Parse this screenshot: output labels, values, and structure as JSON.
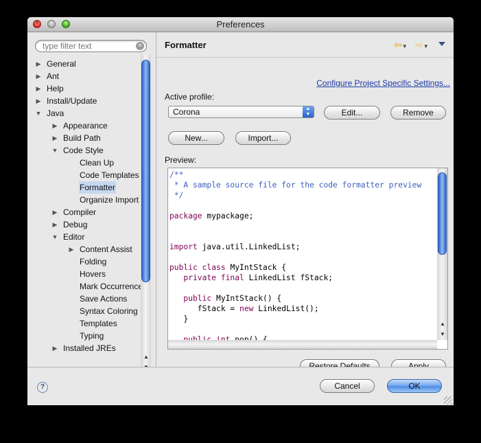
{
  "window": {
    "title": "Preferences"
  },
  "filter": {
    "placeholder": "type filter text"
  },
  "tree": [
    {
      "label": "General",
      "twisty": "collapsed",
      "level": 0,
      "selected": false
    },
    {
      "label": "Ant",
      "twisty": "collapsed",
      "level": 0,
      "selected": false
    },
    {
      "label": "Help",
      "twisty": "collapsed",
      "level": 0,
      "selected": false
    },
    {
      "label": "Install/Update",
      "twisty": "collapsed",
      "level": 0,
      "selected": false
    },
    {
      "label": "Java",
      "twisty": "expanded",
      "level": 0,
      "selected": false
    },
    {
      "label": "Appearance",
      "twisty": "collapsed",
      "level": 1,
      "selected": false
    },
    {
      "label": "Build Path",
      "twisty": "collapsed",
      "level": 1,
      "selected": false
    },
    {
      "label": "Code Style",
      "twisty": "expanded",
      "level": 1,
      "selected": false
    },
    {
      "label": "Clean Up",
      "twisty": "none",
      "level": 2,
      "selected": false
    },
    {
      "label": "Code Templates",
      "twisty": "none",
      "level": 2,
      "selected": false
    },
    {
      "label": "Formatter",
      "twisty": "none",
      "level": 2,
      "selected": true
    },
    {
      "label": "Organize Import",
      "twisty": "none",
      "level": 2,
      "selected": false
    },
    {
      "label": "Compiler",
      "twisty": "collapsed",
      "level": 1,
      "selected": false
    },
    {
      "label": "Debug",
      "twisty": "collapsed",
      "level": 1,
      "selected": false
    },
    {
      "label": "Editor",
      "twisty": "expanded",
      "level": 1,
      "selected": false
    },
    {
      "label": "Content Assist",
      "twisty": "collapsed",
      "level": 2,
      "selected": false
    },
    {
      "label": "Folding",
      "twisty": "none",
      "level": 2,
      "selected": false
    },
    {
      "label": "Hovers",
      "twisty": "none",
      "level": 2,
      "selected": false
    },
    {
      "label": "Mark Occurrences",
      "twisty": "none",
      "level": 2,
      "selected": false
    },
    {
      "label": "Save Actions",
      "twisty": "none",
      "level": 2,
      "selected": false
    },
    {
      "label": "Syntax Coloring",
      "twisty": "none",
      "level": 2,
      "selected": false
    },
    {
      "label": "Templates",
      "twisty": "none",
      "level": 2,
      "selected": false
    },
    {
      "label": "Typing",
      "twisty": "none",
      "level": 2,
      "selected": false
    },
    {
      "label": "Installed JREs",
      "twisty": "collapsed",
      "level": 1,
      "selected": false
    }
  ],
  "page": {
    "title": "Formatter",
    "configure_link": "Configure Project Specific Settings...",
    "active_profile_label": "Active profile:",
    "profile_value": "Corona",
    "edit_label": "Edit...",
    "remove_label": "Remove",
    "new_label": "New...",
    "import_label": "Import...",
    "preview_label": "Preview:",
    "restore_defaults_label": "Restore Defaults",
    "apply_label": "Apply"
  },
  "preview_code": [
    [
      [
        "comment",
        "/**"
      ]
    ],
    [
      [
        "comment",
        " * A sample source file for the code formatter preview"
      ]
    ],
    [
      [
        "comment",
        " */"
      ]
    ],
    [],
    [
      [
        "kw",
        "package"
      ],
      [
        "plain",
        " mypackage;"
      ]
    ],
    [],
    [],
    [
      [
        "kw",
        "import"
      ],
      [
        "plain",
        " java.util.LinkedList;"
      ]
    ],
    [],
    [
      [
        "kw",
        "public"
      ],
      [
        "plain",
        " "
      ],
      [
        "kw",
        "class"
      ],
      [
        "plain",
        " MyIntStack {"
      ]
    ],
    [
      [
        "plain",
        "   "
      ],
      [
        "kw",
        "private"
      ],
      [
        "plain",
        " "
      ],
      [
        "kw",
        "final"
      ],
      [
        "plain",
        " LinkedList fStack;"
      ]
    ],
    [],
    [
      [
        "plain",
        "   "
      ],
      [
        "kw",
        "public"
      ],
      [
        "plain",
        " MyIntStack() {"
      ]
    ],
    [
      [
        "plain",
        "      fStack = "
      ],
      [
        "kw",
        "new"
      ],
      [
        "plain",
        " LinkedList();"
      ]
    ],
    [
      [
        "plain",
        "   }"
      ]
    ],
    [],
    [
      [
        "plain",
        "   "
      ],
      [
        "kw",
        "public"
      ],
      [
        "plain",
        " "
      ],
      [
        "kw",
        "int"
      ],
      [
        "plain",
        " pop() {"
      ]
    ]
  ],
  "footer": {
    "help_glyph": "?",
    "cancel_label": "Cancel",
    "ok_label": "OK"
  },
  "icons": {
    "close": "close-icon",
    "minimize": "minimize-icon",
    "zoom": "zoom-icon",
    "back": "back-arrow-icon",
    "forward": "forward-arrow-icon",
    "menu": "view-menu-icon",
    "help": "help-icon"
  },
  "colors": {
    "selection": "#c6d7f0",
    "keyword": "#7f0055",
    "comment": "#3f5fbf",
    "link": "#1c3aa8",
    "scroll_thumb": "#2f64c6"
  }
}
